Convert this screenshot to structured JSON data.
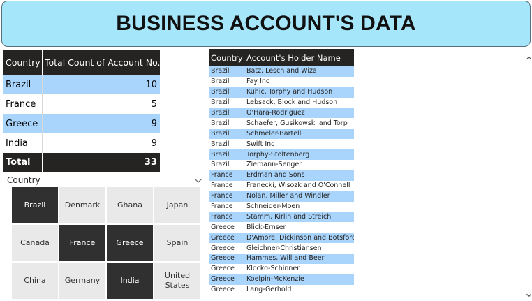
{
  "header": {
    "title": "BUSINESS ACCOUNT'S DATA"
  },
  "summary": {
    "col_country": "Country",
    "col_count": "Total Count of Account No.",
    "rows": [
      {
        "country": "Brazil",
        "count": "10"
      },
      {
        "country": "France",
        "count": "5"
      },
      {
        "country": "Greece",
        "count": "9"
      },
      {
        "country": "India",
        "count": "9"
      }
    ],
    "total_label": "Total",
    "total_value": "33"
  },
  "slicer": {
    "label": "Country",
    "tiles": [
      {
        "label": "Brazil",
        "selected": true
      },
      {
        "label": "Denmark",
        "selected": false
      },
      {
        "label": "Ghana",
        "selected": false
      },
      {
        "label": "Japan",
        "selected": false
      },
      {
        "label": "Canada",
        "selected": false
      },
      {
        "label": "France",
        "selected": true
      },
      {
        "label": "Greece",
        "selected": true
      },
      {
        "label": "Spain",
        "selected": false
      },
      {
        "label": "China",
        "selected": false
      },
      {
        "label": "Germany",
        "selected": false
      },
      {
        "label": "India",
        "selected": true
      },
      {
        "label": "United\nStates",
        "selected": false
      }
    ]
  },
  "detail": {
    "col_country": "Country",
    "col_holder": "Account's Holder Name",
    "rows": [
      {
        "country": "Brazil",
        "holder": "Batz, Lesch and Wiza"
      },
      {
        "country": "Brazil",
        "holder": "Fay Inc"
      },
      {
        "country": "Brazil",
        "holder": "Kuhic, Torphy and Hudson"
      },
      {
        "country": "Brazil",
        "holder": "Lebsack, Block and Hudson"
      },
      {
        "country": "Brazil",
        "holder": "O'Hara-Rodriguez"
      },
      {
        "country": "Brazil",
        "holder": "Schaefer, Gusikowski and Torp"
      },
      {
        "country": "Brazil",
        "holder": "Schmeler-Bartell"
      },
      {
        "country": "Brazil",
        "holder": "Swift Inc"
      },
      {
        "country": "Brazil",
        "holder": "Torphy-Stoltenberg"
      },
      {
        "country": "Brazil",
        "holder": "Ziemann-Senger"
      },
      {
        "country": "France",
        "holder": "Erdman and Sons"
      },
      {
        "country": "France",
        "holder": "Franecki, Wisozk and O'Connell"
      },
      {
        "country": "France",
        "holder": "Nolan, Miller and Windler"
      },
      {
        "country": "France",
        "holder": "Schneider-Moen"
      },
      {
        "country": "France",
        "holder": "Stamm, Kirlin and Streich"
      },
      {
        "country": "Greece",
        "holder": "Blick-Ernser"
      },
      {
        "country": "Greece",
        "holder": "D'Amore, Dickinson and Botsford"
      },
      {
        "country": "Greece",
        "holder": "Gleichner-Christiansen"
      },
      {
        "country": "Greece",
        "holder": "Hammes, Will and Beer"
      },
      {
        "country": "Greece",
        "holder": "Klocko-Schinner"
      },
      {
        "country": "Greece",
        "holder": "Koelpin-McKenzie"
      },
      {
        "country": "Greece",
        "holder": "Lang-Gerhold"
      }
    ]
  },
  "colors": {
    "header_bg": "#a6e6fb",
    "band": "#a9d4fc",
    "dark": "#252423",
    "tile_selected": "#303030",
    "tile_default": "#e9e9e9"
  },
  "icons": {
    "slicer_chevron": "chevron-down-icon",
    "scroll_up": "scroll-up-arrow-icon",
    "scroll_down": "scroll-down-arrow-icon"
  }
}
